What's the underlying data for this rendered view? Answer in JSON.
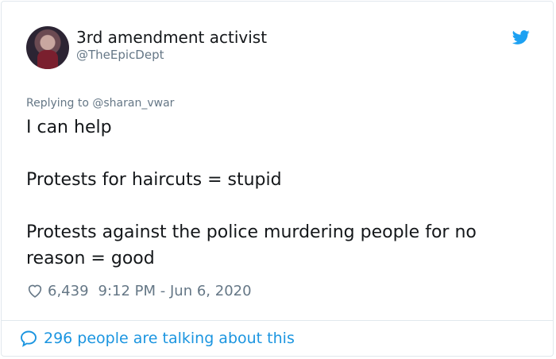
{
  "author": {
    "display_name": "3rd amendment activist",
    "handle": "@TheEpicDept",
    "avatar_icon": "user-avatar"
  },
  "platform_icon": "twitter-bird-icon",
  "reply_context": "Replying to @sharan_vwar",
  "tweet": {
    "lines": [
      "I can help",
      "Protests for haircuts = stupid",
      "Protests against the police murdering people for no reason = good"
    ]
  },
  "meta": {
    "likes": "6,439",
    "timestamp": "9:12 PM - Jun 6, 2020",
    "like_icon": "heart-icon"
  },
  "footer": {
    "label": "296 people are talking about this",
    "icon": "speech-bubble-icon"
  },
  "colors": {
    "text": "#14171a",
    "muted": "#657786",
    "accent": "#1b95e0",
    "border": "#e1e8ed"
  }
}
